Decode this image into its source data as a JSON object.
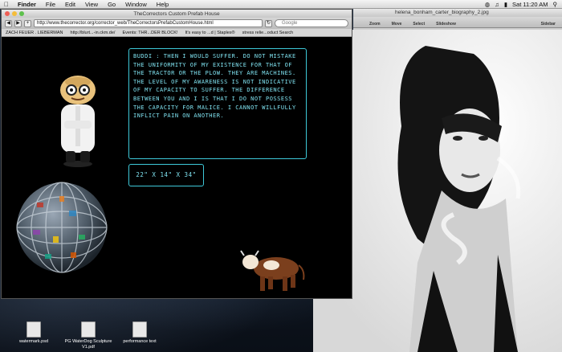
{
  "menubar": {
    "app": "Finder",
    "items": [
      "File",
      "Edit",
      "View",
      "Go",
      "Window",
      "Help"
    ],
    "clock": "Sat 11:20 AM"
  },
  "browser": {
    "title": "TheCorrectors Custom Prefab House",
    "url": "http://www.thecorrector.org/corrector_web/TheCorrectorsPrefabCustomHouse.html",
    "search_placeholder": "Google",
    "bookmarks": [
      "ZACH FEUER . LIEBERMAN",
      "http://blurt...-in.ckm.de/",
      "Events: THR...DER BLOCK!",
      "It's easy to ...d | Staples®",
      "stress relie...oduct Search"
    ],
    "page": {
      "quote": "Buddi : Then I would suffer. Do not mistake the uniformity of my existence for that of the tractor or the plow. They are machines. The level of my awareness is not indicative of my capacity to suffer. The difference between you and I is that I do not possess the capacity for malice. I cannot willfully inflict pain on another.",
      "dimensions": "22\" x 14\" x 34\""
    }
  },
  "viewer": {
    "title": "helena_bonham_carter_biography_2.jpg",
    "tools": [
      "Zoom",
      "Move",
      "Select",
      "Slideshow",
      "Sidebar"
    ]
  },
  "desktop_icons": [
    {
      "label": "watermark.psd"
    },
    {
      "label": "PG WaterDog Sculpture V1.pdf"
    },
    {
      "label": "performance text"
    }
  ],
  "colors": {
    "accent": "#3ec9d9",
    "quote_text": "#7fe2f0"
  }
}
